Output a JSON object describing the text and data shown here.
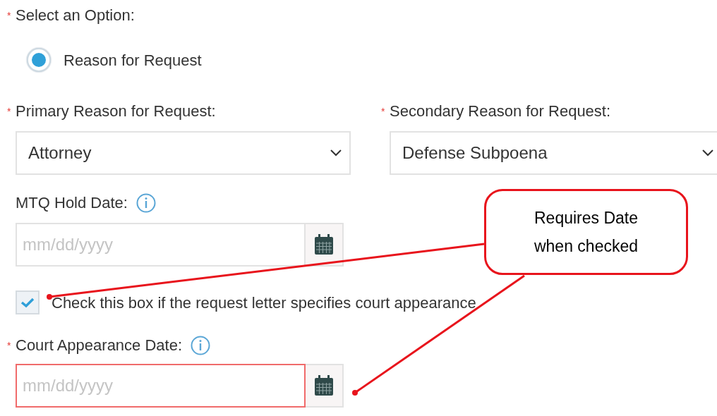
{
  "option_group": {
    "required_mark": "*",
    "label": "Select an Option:",
    "options": [
      {
        "label": "Reason for Request",
        "selected": true
      }
    ]
  },
  "primary_reason": {
    "required_mark": "*",
    "label": "Primary Reason for Request:",
    "value": "Attorney"
  },
  "secondary_reason": {
    "required_mark": "*",
    "label": "Secondary Reason for Request:",
    "value": "Defense Subpoena"
  },
  "mtq_hold_date": {
    "label": "MTQ Hold Date:",
    "placeholder": "mm/dd/yyyy",
    "error": false
  },
  "court_appearance_checkbox": {
    "label": "Check this box if the request letter specifies court appearance",
    "checked": true
  },
  "court_appearance_date": {
    "required_mark": "*",
    "label": "Court Appearance Date:",
    "placeholder": "mm/dd/yyyy",
    "error": true
  },
  "callout": {
    "text": "Requires Date when checked"
  }
}
